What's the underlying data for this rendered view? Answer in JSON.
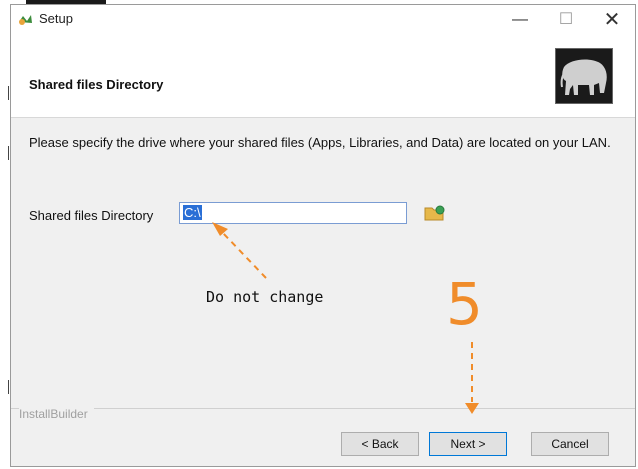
{
  "window": {
    "title": "Setup",
    "controls": {
      "minimize": "—",
      "maximize": "☐",
      "close": "✕"
    }
  },
  "header": {
    "title": "Shared files Directory",
    "logo_icon": "elephant-logo-icon"
  },
  "content": {
    "description": "Please specify the drive where your shared files (Apps, Libraries, and Data) are located on your LAN.",
    "field_label": "Shared files Directory",
    "field_value": "C:\\",
    "browse_icon": "folder-browse-icon"
  },
  "annotations": {
    "note": "Do not change",
    "step": "5",
    "color": "#f08c2a"
  },
  "footer": {
    "brand": "InstallBuilder",
    "back_label": "< Back",
    "next_label": "Next >",
    "cancel_label": "Cancel"
  }
}
